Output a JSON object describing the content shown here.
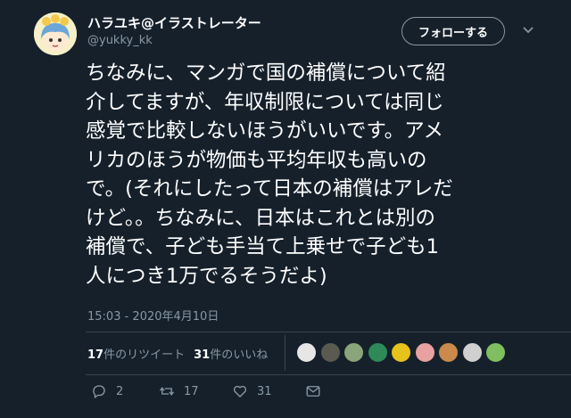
{
  "author": {
    "display_name": "ハラユキ@イラストレーター",
    "handle": "@yukky_kk",
    "avatar_icon": "user-avatar-illustration"
  },
  "follow_button_label": "フォローする",
  "tweet": {
    "text": "ちなみに、マンガで国の補償について紹\n介してますが、年収制限については同じ\n感覚で比較しないほうがいいです。アメ\nリカのほうが物価も平均年収も高いの\nで。(それにしたって日本の補償はアレだ\nけど。。ちなみに、日本はこれとは別の\n補償で、子ども手当て上乗せで子ども1\n人につき1万でるそうだよ)",
    "timestamp": "15:03 - 2020年4月10日"
  },
  "stats": {
    "retweets_count": "17",
    "retweets_label": "件のリツイート",
    "likes_count": "31",
    "likes_label": "件のいいね"
  },
  "likers": [
    {
      "icon": "liker-avatar-1",
      "color": "#e6e6e6"
    },
    {
      "icon": "liker-avatar-2",
      "color": "#5a5a50"
    },
    {
      "icon": "liker-avatar-3",
      "color": "#8aa57a"
    },
    {
      "icon": "liker-avatar-4",
      "color": "#2e8b57"
    },
    {
      "icon": "liker-avatar-5",
      "color": "#e6c21a"
    },
    {
      "icon": "liker-avatar-6",
      "color": "#e8a0a0"
    },
    {
      "icon": "liker-avatar-7",
      "color": "#c98a4b"
    },
    {
      "icon": "liker-avatar-8",
      "color": "#d0d0d0"
    },
    {
      "icon": "liker-avatar-9",
      "color": "#7fbf5f"
    }
  ],
  "actions": {
    "reply_count": "2",
    "retweet_count": "17",
    "like_count": "31"
  },
  "colors": {
    "background": "#15202b",
    "secondary_text": "#8899a6",
    "divider": "#38444d"
  }
}
